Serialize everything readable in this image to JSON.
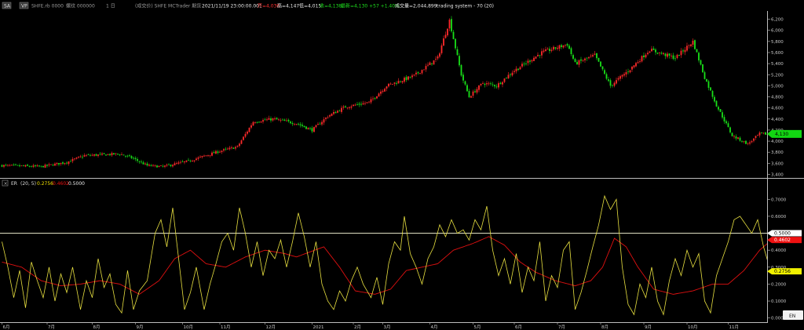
{
  "header": {
    "badge_1": "SA",
    "badge_2": "VP",
    "symbol": "SHFE.rb 0000",
    "code": "螺纹 000000",
    "period": "1 日",
    "info": "(成交价) SHFE MCTrader 期货",
    "datetime": "2021/11/19 23:00:00.001",
    "open": "开=4,036",
    "high": "高=4,147",
    "low": "低=4,015",
    "close": "收=4,138",
    "last": "最新=4,130 +57 +1.40%",
    "volume": "成交量=2,044,899",
    "strategy": "trading system - 70 (20)"
  },
  "sub_header": {
    "name": "ER",
    "params": "(20, 5)",
    "v1": "0.2756",
    "v2": "0.4602",
    "v3": "0.5000"
  },
  "colors": {
    "up": "#ff2a2a",
    "down": "#19e019",
    "er_line": "#e8e040",
    "er_ma": "#e01010",
    "level_line": "#ffffdd",
    "last_tag": "#12d612",
    "ma_tag": "#ee1111",
    "er_tag": "#f0f000"
  },
  "chart_data": [
    {
      "type": "candlestick",
      "title": "SHFE.rb 0000 螺纹 1 日",
      "yticks": [
        3400,
        3600,
        3800,
        4000,
        4200,
        4400,
        4600,
        4800,
        5000,
        5200,
        5400,
        5600,
        5800,
        6000,
        6200
      ],
      "ylim": [
        3350,
        6350
      ],
      "last_price": 4130,
      "last_price_label": "4,130",
      "anchors": [
        {
          "d": 0,
          "p": 3560
        },
        {
          "d": 20,
          "p": 3540
        },
        {
          "d": 33,
          "p": 3620
        },
        {
          "d": 42,
          "p": 3740
        },
        {
          "d": 60,
          "p": 3770
        },
        {
          "d": 66,
          "p": 3700
        },
        {
          "d": 74,
          "p": 3560
        },
        {
          "d": 82,
          "p": 3540
        },
        {
          "d": 95,
          "p": 3640
        },
        {
          "d": 110,
          "p": 3810
        },
        {
          "d": 120,
          "p": 3900
        },
        {
          "d": 128,
          "p": 4350
        },
        {
          "d": 138,
          "p": 4400
        },
        {
          "d": 150,
          "p": 4320
        },
        {
          "d": 158,
          "p": 4200
        },
        {
          "d": 166,
          "p": 4450
        },
        {
          "d": 175,
          "p": 4620
        },
        {
          "d": 187,
          "p": 4700
        },
        {
          "d": 196,
          "p": 5000
        },
        {
          "d": 210,
          "p": 5180
        },
        {
          "d": 222,
          "p": 5500
        },
        {
          "d": 228,
          "p": 6180
        },
        {
          "d": 234,
          "p": 5200
        },
        {
          "d": 238,
          "p": 4800
        },
        {
          "d": 245,
          "p": 5050
        },
        {
          "d": 252,
          "p": 5000
        },
        {
          "d": 260,
          "p": 5250
        },
        {
          "d": 275,
          "p": 5600
        },
        {
          "d": 288,
          "p": 5750
        },
        {
          "d": 292,
          "p": 5400
        },
        {
          "d": 302,
          "p": 5550
        },
        {
          "d": 310,
          "p": 5000
        },
        {
          "d": 320,
          "p": 5300
        },
        {
          "d": 330,
          "p": 5650
        },
        {
          "d": 343,
          "p": 5500
        },
        {
          "d": 352,
          "p": 5800
        },
        {
          "d": 358,
          "p": 5150
        },
        {
          "d": 364,
          "p": 4650
        },
        {
          "d": 372,
          "p": 4100
        },
        {
          "d": 380,
          "p": 3950
        },
        {
          "d": 386,
          "p": 4130
        }
      ]
    },
    {
      "type": "line",
      "title": "ER (20, 5)",
      "yticks": [
        0.0005,
        0.1,
        0.2,
        0.3,
        0.4,
        0.5,
        0.6,
        0.7
      ],
      "ytick_labels": [
        "0.0005",
        "0.1000",
        "0.2000",
        "0.3000",
        "0.4000",
        "0.5000",
        "0.6000",
        "0.7000"
      ],
      "ylim": [
        -0.02,
        0.78
      ],
      "level": 0.5,
      "last_values": {
        "er": 0.2756,
        "ma": 0.4602,
        "level": 0.5
      },
      "series": [
        {
          "key": "er_anchors",
          "values": [
            [
              0,
              0.45
            ],
            [
              3,
              0.3
            ],
            [
              6,
              0.12
            ],
            [
              9,
              0.28
            ],
            [
              12,
              0.06
            ],
            [
              15,
              0.33
            ],
            [
              18,
              0.22
            ],
            [
              21,
              0.12
            ],
            [
              24,
              0.3
            ],
            [
              27,
              0.1
            ],
            [
              30,
              0.26
            ],
            [
              33,
              0.15
            ],
            [
              36,
              0.3
            ],
            [
              40,
              0.05
            ],
            [
              43,
              0.22
            ],
            [
              46,
              0.12
            ],
            [
              49,
              0.35
            ],
            [
              52,
              0.18
            ],
            [
              55,
              0.26
            ],
            [
              58,
              0.08
            ],
            [
              61,
              0.03
            ],
            [
              64,
              0.28
            ],
            [
              67,
              0.05
            ],
            [
              70,
              0.16
            ],
            [
              74,
              0.22
            ],
            [
              78,
              0.5
            ],
            [
              81,
              0.58
            ],
            [
              84,
              0.42
            ],
            [
              87,
              0.65
            ],
            [
              90,
              0.35
            ],
            [
              93,
              0.05
            ],
            [
              96,
              0.15
            ],
            [
              99,
              0.3
            ],
            [
              103,
              0.05
            ],
            [
              106,
              0.2
            ],
            [
              109,
              0.32
            ],
            [
              112,
              0.45
            ],
            [
              115,
              0.5
            ],
            [
              118,
              0.4
            ],
            [
              121,
              0.65
            ],
            [
              124,
              0.5
            ],
            [
              127,
              0.3
            ],
            [
              130,
              0.45
            ],
            [
              133,
              0.25
            ],
            [
              136,
              0.4
            ],
            [
              139,
              0.35
            ],
            [
              142,
              0.46
            ],
            [
              145,
              0.3
            ],
            [
              148,
              0.45
            ],
            [
              151,
              0.62
            ],
            [
              154,
              0.48
            ],
            [
              157,
              0.3
            ],
            [
              160,
              0.45
            ],
            [
              163,
              0.2
            ],
            [
              166,
              0.1
            ],
            [
              169,
              0.05
            ],
            [
              172,
              0.16
            ],
            [
              175,
              0.1
            ],
            [
              178,
              0.22
            ],
            [
              181,
              0.3
            ],
            [
              184,
              0.2
            ],
            [
              188,
              0.12
            ],
            [
              191,
              0.24
            ],
            [
              194,
              0.08
            ],
            [
              197,
              0.32
            ],
            [
              200,
              0.45
            ],
            [
              203,
              0.4
            ],
            [
              205,
              0.6
            ],
            [
              208,
              0.38
            ],
            [
              211,
              0.3
            ],
            [
              214,
              0.2
            ],
            [
              217,
              0.35
            ],
            [
              220,
              0.42
            ],
            [
              223,
              0.55
            ],
            [
              226,
              0.48
            ],
            [
              229,
              0.58
            ],
            [
              232,
              0.5
            ],
            [
              235,
              0.52
            ],
            [
              238,
              0.46
            ],
            [
              241,
              0.58
            ],
            [
              244,
              0.52
            ],
            [
              247,
              0.66
            ],
            [
              250,
              0.4
            ],
            [
              253,
              0.25
            ],
            [
              256,
              0.35
            ],
            [
              259,
              0.2
            ],
            [
              262,
              0.38
            ],
            [
              265,
              0.15
            ],
            [
              268,
              0.3
            ],
            [
              271,
              0.22
            ],
            [
              274,
              0.45
            ],
            [
              277,
              0.1
            ],
            [
              280,
              0.25
            ],
            [
              283,
              0.18
            ],
            [
              286,
              0.4
            ],
            [
              289,
              0.45
            ],
            [
              292,
              0.05
            ],
            [
              295,
              0.15
            ],
            [
              298,
              0.28
            ],
            [
              301,
              0.42
            ],
            [
              304,
              0.55
            ],
            [
              307,
              0.72
            ],
            [
              310,
              0.64
            ],
            [
              313,
              0.7
            ],
            [
              316,
              0.3
            ],
            [
              319,
              0.08
            ],
            [
              322,
              0.02
            ],
            [
              325,
              0.2
            ],
            [
              328,
              0.12
            ],
            [
              331,
              0.3
            ],
            [
              334,
              0.1
            ],
            [
              337,
              0.02
            ],
            [
              340,
              0.22
            ],
            [
              343,
              0.35
            ],
            [
              346,
              0.25
            ],
            [
              349,
              0.4
            ],
            [
              352,
              0.3
            ],
            [
              355,
              0.38
            ],
            [
              358,
              0.1
            ],
            [
              361,
              0.03
            ],
            [
              364,
              0.25
            ],
            [
              367,
              0.35
            ],
            [
              370,
              0.45
            ],
            [
              373,
              0.58
            ],
            [
              376,
              0.6
            ],
            [
              379,
              0.55
            ],
            [
              382,
              0.5
            ],
            [
              385,
              0.58
            ],
            [
              388,
              0.42
            ],
            [
              391,
              0.3
            ],
            [
              392,
              0.2756
            ]
          ]
        },
        {
          "key": "ma_anchors",
          "values": [
            [
              0,
              0.33
            ],
            [
              10,
              0.3
            ],
            [
              20,
              0.22
            ],
            [
              30,
              0.19
            ],
            [
              40,
              0.2
            ],
            [
              50,
              0.22
            ],
            [
              60,
              0.2
            ],
            [
              70,
              0.14
            ],
            [
              80,
              0.22
            ],
            [
              88,
              0.35
            ],
            [
              96,
              0.4
            ],
            [
              104,
              0.32
            ],
            [
              114,
              0.3
            ],
            [
              124,
              0.36
            ],
            [
              134,
              0.4
            ],
            [
              144,
              0.38
            ],
            [
              150,
              0.36
            ],
            [
              157,
              0.39
            ],
            [
              164,
              0.42
            ],
            [
              172,
              0.3
            ],
            [
              180,
              0.16
            ],
            [
              190,
              0.14
            ],
            [
              198,
              0.17
            ],
            [
              206,
              0.28
            ],
            [
              214,
              0.3
            ],
            [
              222,
              0.32
            ],
            [
              230,
              0.4
            ],
            [
              240,
              0.44
            ],
            [
              248,
              0.48
            ],
            [
              256,
              0.43
            ],
            [
              264,
              0.33
            ],
            [
              272,
              0.27
            ],
            [
              282,
              0.22
            ],
            [
              292,
              0.19
            ],
            [
              300,
              0.22
            ],
            [
              306,
              0.3
            ],
            [
              312,
              0.47
            ],
            [
              318,
              0.42
            ],
            [
              324,
              0.3
            ],
            [
              332,
              0.17
            ],
            [
              342,
              0.14
            ],
            [
              352,
              0.16
            ],
            [
              362,
              0.2
            ],
            [
              370,
              0.2
            ],
            [
              378,
              0.28
            ],
            [
              386,
              0.4
            ],
            [
              392,
              0.4602
            ]
          ]
        }
      ]
    }
  ],
  "x_axis": {
    "labels": [
      {
        "d": 0,
        "t": "6月"
      },
      {
        "d": 23,
        "t": "7月"
      },
      {
        "d": 46,
        "t": "8月"
      },
      {
        "d": 68,
        "t": "9月"
      },
      {
        "d": 92,
        "t": "10月"
      },
      {
        "d": 111,
        "t": "11月"
      },
      {
        "d": 134,
        "t": "12月"
      },
      {
        "d": 158,
        "t": "2021"
      },
      {
        "d": 179,
        "t": "2月"
      },
      {
        "d": 194,
        "t": "3月"
      },
      {
        "d": 218,
        "t": "4月"
      },
      {
        "d": 240,
        "t": "5月"
      },
      {
        "d": 261,
        "t": "6月"
      },
      {
        "d": 283,
        "t": "7月"
      },
      {
        "d": 305,
        "t": "8月"
      },
      {
        "d": 327,
        "t": "9月"
      },
      {
        "d": 349,
        "t": "10月"
      },
      {
        "d": 370,
        "t": "11月"
      }
    ]
  },
  "corner_button": "EN"
}
